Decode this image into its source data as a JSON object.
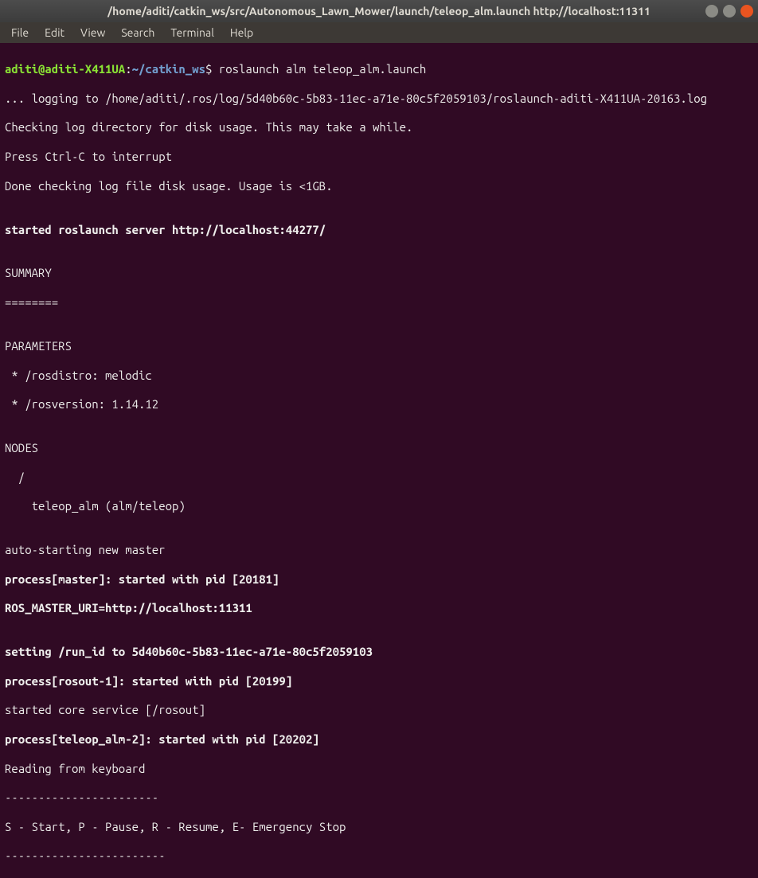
{
  "window": {
    "title": "/home/aditi/catkin_ws/src/Autonomous_Lawn_Mower/launch/teleop_alm.launch http://localhost:11311"
  },
  "menu": {
    "file": "File",
    "edit": "Edit",
    "view": "View",
    "search": "Search",
    "terminal": "Terminal",
    "help": "Help"
  },
  "prompt": {
    "user_host": "aditi@aditi-X411UA",
    "sep": ":",
    "cwd": "~/catkin_ws",
    "dollar": "$ ",
    "command": "roslaunch alm teleop_alm.launch"
  },
  "lines": {
    "l01": "... logging to /home/aditi/.ros/log/5d40b60c-5b83-11ec-a71e-80c5f2059103/roslaunch-aditi-X411UA-20163.log",
    "l02": "Checking log directory for disk usage. This may take a while.",
    "l03": "Press Ctrl-C to interrupt",
    "l04": "Done checking log file disk usage. Usage is <1GB.",
    "l05": "",
    "l06": "started roslaunch server http://localhost:44277/",
    "l07": "",
    "l08": "SUMMARY",
    "l09": "========",
    "l10": "",
    "l11": "PARAMETERS",
    "l12": " * /rosdistro: melodic",
    "l13": " * /rosversion: 1.14.12",
    "l14": "",
    "l15": "NODES",
    "l16": "  /",
    "l17": "    teleop_alm (alm/teleop)",
    "l18": "",
    "l19": "auto-starting new master",
    "l20": "process[master]: started with pid [20181]",
    "l21": "ROS_MASTER_URI=http://localhost:11311",
    "l22": "",
    "l23": "setting /run_id to 5d40b60c-5b83-11ec-a71e-80c5f2059103",
    "l24": "process[rosout-1]: started with pid [20199]",
    "l25": "started core service [/rosout]",
    "l26": "process[teleop_alm-2]: started with pid [20202]",
    "l27": "Reading from keyboard",
    "l28": "-----------------------",
    "l29": "S - Start, P - Pause, R - Resume, E- Emergency Stop",
    "l30": "------------------------"
  }
}
